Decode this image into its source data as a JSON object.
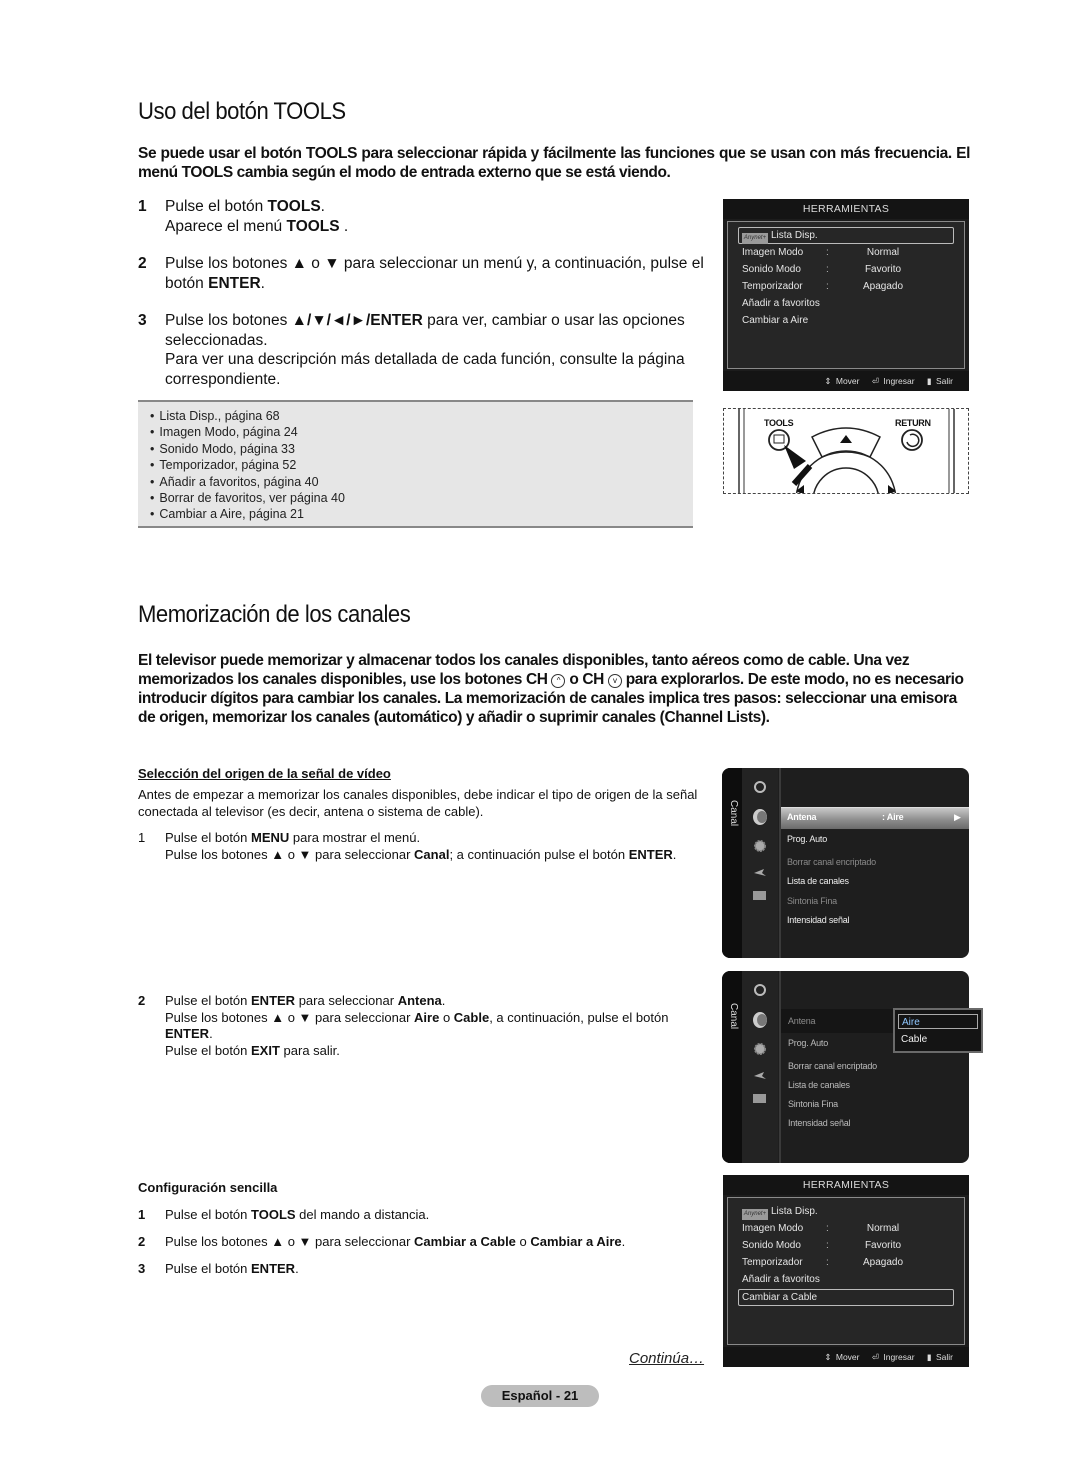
{
  "section1": {
    "title": "Uso del botón TOOLS",
    "intro": "Se puede usar el botón TOOLS para seleccionar rápida y fácilmente las funciones que se usan con más frecuencia. El menú TOOLS cambia según el modo de entrada externo que se está viendo.",
    "steps": [
      {
        "num": "1",
        "line1_pre": "Pulse el botón ",
        "line1_bold": "TOOLS",
        "line1_post": ".",
        "line2_pre": "Aparece el menú ",
        "line2_bold": "TOOLS",
        "line2_post": " ."
      },
      {
        "num": "2",
        "pre": "Pulse los botones ▲ o ▼ para seleccionar un menú y, a continuación, pulse el botón ",
        "bold": "ENTER",
        "post": "."
      },
      {
        "num": "3",
        "pre": "Pulse los botones ",
        "bold": "▲/▼/◄/►/ENTER",
        "post": " para ver, cambiar o usar las opciones seleccionadas.",
        "extra": "Para ver una descripción más detallada de cada función, consulte la página correspondiente."
      }
    ],
    "references": [
      "Lista Disp., página 68",
      "Imagen Modo, página 24",
      "Sonido Modo, página 33",
      "Temporizador, página 52",
      "Añadir a favoritos, página 40",
      "Borrar de favoritos, ver página 40",
      "Cambiar a Aire, página 21"
    ]
  },
  "tools_menu_1": {
    "title": "HERRAMIENTAS",
    "anynet_label": "Anynet+",
    "items": [
      {
        "label": "Lista Disp.",
        "sep": "",
        "value": ""
      },
      {
        "label": "Imagen Modo",
        "sep": ":",
        "value": "Normal"
      },
      {
        "label": "Sonido Modo",
        "sep": ":",
        "value": "Favorito"
      },
      {
        "label": "Temporizador",
        "sep": ":",
        "value": "Apagado"
      },
      {
        "label": "Añadir a favoritos",
        "sep": "",
        "value": ""
      },
      {
        "label": "Cambiar a Aire",
        "sep": "",
        "value": ""
      }
    ],
    "selected": "Lista Disp.",
    "footer": {
      "move": "Mover",
      "enter": "Ingresar",
      "exit": "Salir"
    }
  },
  "remote": {
    "tools_label": "TOOLS",
    "return_label": "RETURN"
  },
  "section2": {
    "title": "Memorización de los canales",
    "intro_part1": "El televisor puede memorizar y almacenar todos los canales disponibles, tanto aéreos como de cable. Una vez memorizados los canales disponibles, use los botones CH ",
    "intro_part2": " o CH ",
    "intro_part3": " para explorarlos. De este modo, no es necesario introducir dígitos para cambiar los canales. La memorización de canales implica tres pasos: seleccionar una emisora de origen, memorizar los canales (automático) y añadir o suprimir canales (Channel Lists).",
    "subsection1": {
      "title": "Selección del origen de la señal de vídeo",
      "paragraph": "Antes de empezar a memorizar los canales disponibles, debe indicar el tipo de origen de la señal conectada al televisor (es decir, antena o sistema de cable).",
      "step1": {
        "num": "1",
        "a_pre": "Pulse el botón ",
        "a_bold": "MENU",
        "a_post": " para mostrar el menú.",
        "b_pre": "Pulse los botones ▲ o ▼ para seleccionar ",
        "b_bold": "Canal",
        "b_post": "; a continuación pulse el botón ",
        "b_bold2": "ENTER",
        "b_post2": "."
      },
      "step2": {
        "num": "2",
        "a_pre": "Pulse el botón ",
        "a_bold": "ENTER",
        "a_mid": " para seleccionar ",
        "a_bold2": "Antena",
        "a_post": ".",
        "b_pre": "Pulse los botones ▲ o ▼ para seleccionar ",
        "b_bold": "Aire",
        "b_mid": " o ",
        "b_bold2": "Cable",
        "b_post": ", a continuación, pulse el botón ",
        "b_bold3": "ENTER",
        "b_post2": ".",
        "c_pre": "Pulse el botón ",
        "c_bold": "EXIT",
        "c_post": " para salir."
      }
    },
    "subsection2": {
      "title": "Configuración sencilla",
      "steps": [
        {
          "num": "1",
          "pre": "Pulse el botón ",
          "bold": "TOOLS",
          "post": " del mando a distancia."
        },
        {
          "num": "2",
          "pre": "Pulse los botones ▲ o ▼ para seleccionar ",
          "bold": "Cambiar a Cable",
          "mid": " o ",
          "bold2": "Cambiar a Aire",
          "post": "."
        },
        {
          "num": "3",
          "pre": "Pulse el botón ",
          "bold": "ENTER",
          "post": "."
        }
      ]
    }
  },
  "canal_menu_1": {
    "side_label": "Canal",
    "items": [
      {
        "label": "Antena",
        "value": ": Aire",
        "state": "highlighted"
      },
      {
        "label": "Prog. Auto",
        "state": "normal"
      },
      {
        "label": "Borrar canal encriptado",
        "state": "dim"
      },
      {
        "label": "Lista de canales",
        "state": "normal"
      },
      {
        "label": "Sintonia Fina",
        "state": "dim"
      },
      {
        "label": "Intensidad señal",
        "state": "normal"
      }
    ]
  },
  "canal_menu_2": {
    "side_label": "Canal",
    "items": [
      {
        "label": "Antena",
        "state": "dim"
      },
      {
        "label": "Prog. Auto",
        "state": "dim"
      },
      {
        "label": "Borrar canal encriptado",
        "state": "dim"
      },
      {
        "label": "Lista de canales",
        "state": "dim"
      },
      {
        "label": "Sintonia Fina",
        "state": "dim"
      },
      {
        "label": "Intensidad señal",
        "state": "dim"
      }
    ],
    "dropdown": {
      "options": [
        "Aire",
        "Cable"
      ],
      "selected": "Aire"
    }
  },
  "tools_menu_2": {
    "title": "HERRAMIENTAS",
    "anynet_label": "Anynet+",
    "items": [
      {
        "label": "Lista Disp.",
        "sep": "",
        "value": ""
      },
      {
        "label": "Imagen Modo",
        "sep": ":",
        "value": "Normal"
      },
      {
        "label": "Sonido Modo",
        "sep": ":",
        "value": "Favorito"
      },
      {
        "label": "Temporizador",
        "sep": ":",
        "value": "Apagado"
      },
      {
        "label": "Añadir a favoritos",
        "sep": "",
        "value": ""
      },
      {
        "label": "Cambiar a Cable",
        "sep": "",
        "value": ""
      }
    ],
    "selected": "Cambiar a Cable",
    "footer": {
      "move": "Mover",
      "enter": "Ingresar",
      "exit": "Salir"
    }
  },
  "footer": {
    "continue": "Continúa…",
    "page_label": "Español - 21"
  }
}
